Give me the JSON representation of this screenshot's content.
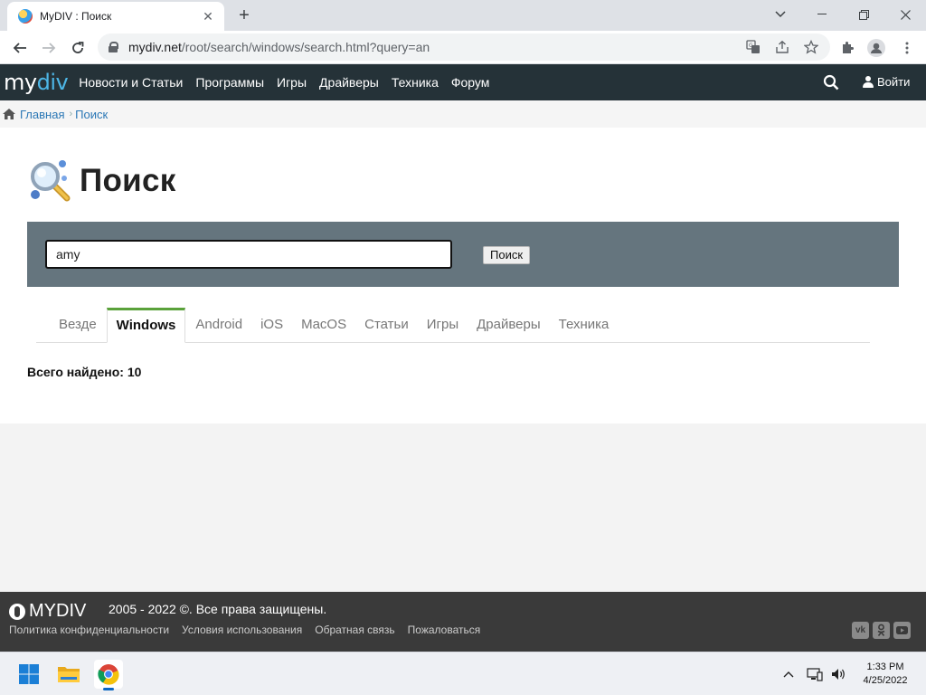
{
  "browser": {
    "tab_title": "MyDIV : Поиск",
    "url_host": "mydiv.net",
    "url_path": "/root/search/windows/search.html?query=an"
  },
  "site_nav": {
    "logo_my": "my",
    "logo_div": "div",
    "menu": [
      "Новости и Статьи",
      "Программы",
      "Игры",
      "Драйверы",
      "Техника",
      "Форум"
    ],
    "login": "Войти"
  },
  "breadcrumb": {
    "home": "Главная",
    "current": "Поиск"
  },
  "search": {
    "title": "Поиск",
    "query": "amy",
    "button": "Поиск",
    "tabs": [
      "Везде",
      "Windows",
      "Android",
      "iOS",
      "MacOS",
      "Статьи",
      "Игры",
      "Драйверы",
      "Техника"
    ],
    "active_tab": "Windows",
    "total": "Всего найдено: 10"
  },
  "footer": {
    "logo": "MYDIV",
    "copyright": "2005 - 2022 ©. Все права защищены.",
    "links": [
      "Политика конфиденциальности",
      "Условия использования",
      "Обратная связь",
      "Пожаловаться"
    ],
    "social_icons": [
      "vk-icon",
      "odnoklassniki-icon",
      "youtube-icon"
    ]
  },
  "taskbar": {
    "time": "1:33 PM",
    "date": "4/25/2022"
  },
  "colors": {
    "nav_bg": "#253238",
    "accent_tab": "#5aa23a",
    "search_panel": "#65757e",
    "link": "#2a77b5",
    "footer_bg": "#3a3a3a"
  }
}
